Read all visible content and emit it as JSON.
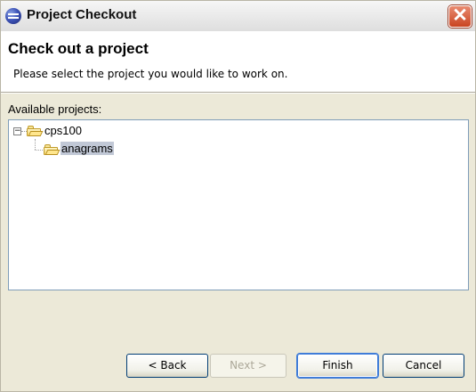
{
  "window": {
    "title": "Project Checkout",
    "close_icon": "close-icon"
  },
  "banner": {
    "title": "Check out a project",
    "description": "Please select the project you would like to work on."
  },
  "content": {
    "available_label": "Available projects:",
    "tree": {
      "root": {
        "label": "cps100",
        "expanded": true,
        "icon": "folder-open-icon",
        "children": [
          {
            "label": "anagrams",
            "selected": true,
            "icon": "folder-open-icon"
          }
        ]
      }
    }
  },
  "buttons": {
    "back": "< Back",
    "next": "Next >",
    "finish": "Finish",
    "cancel": "Cancel"
  },
  "colors": {
    "selection": "#c1c8d6",
    "close_red": "#c94421"
  }
}
